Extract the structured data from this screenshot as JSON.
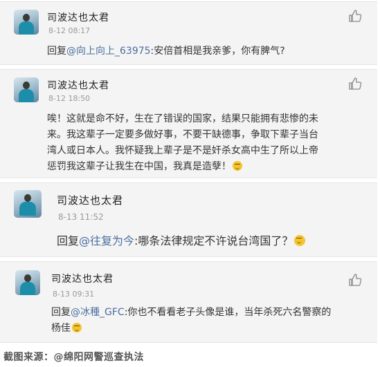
{
  "comments": [
    {
      "author": "司波达也太君",
      "time": "8-12 08:17",
      "reply_prefix": "回复",
      "mention": "@向上向上_63975",
      "body": ":安倍首相是我亲爹，你有脾气?"
    },
    {
      "author": "司波达也太君",
      "time": "8-12 18:50",
      "lines": [
        "唉！这就是命不好，生在了错误的国家，结果只能拥有悲惨的未",
        "来。我这辈子一定要多做好事，不要干缺德事，争取下辈子当台",
        "湾人或日本人。我怀疑我上辈子是不是奸杀女高中生了所以上帝",
        "惩罚我这辈子让我生在中国，我真是造孽！"
      ]
    },
    {
      "author": "司波达也太君",
      "time": "8-13 11:52",
      "reply_prefix": "回复",
      "mention": "@往复为今",
      "body": ":哪条法律规定不许说台湾国了？"
    },
    {
      "author": "司波达也太君",
      "time": "8-13 09:31",
      "reply_prefix": "回复",
      "mention": "@冰種_GFC",
      "body": ":你也不看看老子头像是谁，当年杀死六名警察的",
      "body_line2": "杨佳"
    }
  ],
  "caption": "截图来源：@绵阳网警巡查执法",
  "colors": {
    "card_bg": "#f4f4f4",
    "mention": "#4a6fa0",
    "time": "#999999"
  },
  "icons": {
    "like": "thumbs-up-icon",
    "emoji": "grin-emoji-icon"
  }
}
